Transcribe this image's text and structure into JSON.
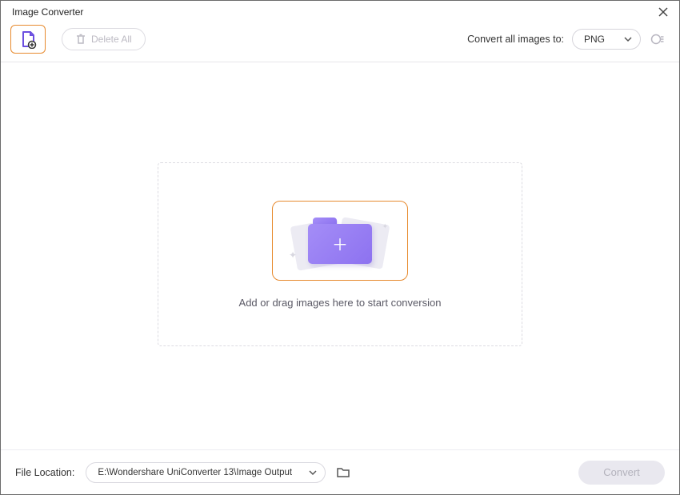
{
  "window": {
    "title": "Image Converter"
  },
  "toolbar": {
    "delete_all_label": "Delete All",
    "convert_all_label": "Convert all images to:",
    "format_selected": "PNG"
  },
  "dropzone": {
    "hint": "Add or drag images here to start conversion"
  },
  "footer": {
    "file_location_label": "File Location:",
    "file_path": "E:\\Wondershare UniConverter 13\\Image Output",
    "convert_label": "Convert"
  }
}
